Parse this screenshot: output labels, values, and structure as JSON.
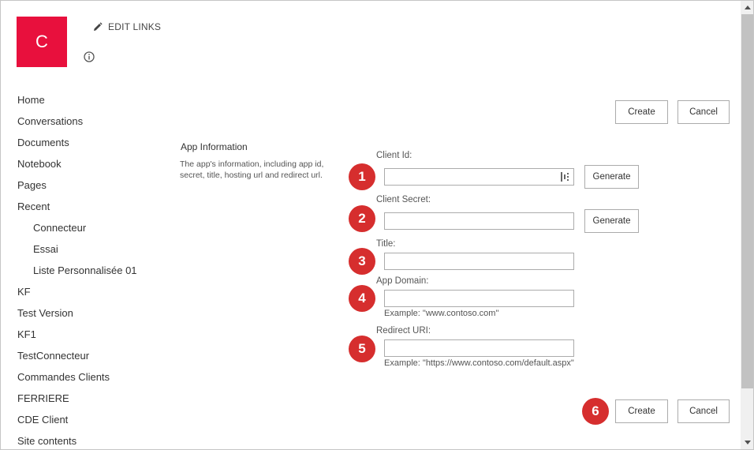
{
  "site": {
    "logo_letter": "C",
    "logo_color": "#e8103d",
    "edit_links": "EDIT LINKS",
    "info_icon": "info-icon"
  },
  "nav": {
    "items": [
      {
        "label": "Home",
        "sub": false
      },
      {
        "label": "Conversations",
        "sub": false
      },
      {
        "label": "Documents",
        "sub": false
      },
      {
        "label": "Notebook",
        "sub": false
      },
      {
        "label": "Pages",
        "sub": false
      },
      {
        "label": "Recent",
        "sub": false
      },
      {
        "label": "Connecteur",
        "sub": true
      },
      {
        "label": "Essai",
        "sub": true
      },
      {
        "label": "Liste Personnalisée 01",
        "sub": true
      },
      {
        "label": "KF",
        "sub": false
      },
      {
        "label": "Test Version",
        "sub": false
      },
      {
        "label": "KF1",
        "sub": false
      },
      {
        "label": "TestConnecteur",
        "sub": false
      },
      {
        "label": "Commandes Clients",
        "sub": false
      },
      {
        "label": "FERRIERE",
        "sub": false
      },
      {
        "label": "CDE Client",
        "sub": false
      },
      {
        "label": "Site contents",
        "sub": false
      }
    ]
  },
  "actions": {
    "create_label": "Create",
    "cancel_label": "Cancel"
  },
  "form": {
    "section_title": "App Information",
    "section_description": "The app's information, including app id, secret, title, hosting url and redirect url.",
    "client_id": {
      "label": "Client Id:",
      "value": "",
      "generate_label": "Generate"
    },
    "client_secret": {
      "label": "Client Secret:",
      "value": "",
      "generate_label": "Generate"
    },
    "title": {
      "label": "Title:",
      "value": ""
    },
    "app_domain": {
      "label": "App Domain:",
      "value": "",
      "example": "Example: \"www.contoso.com\""
    },
    "redirect_uri": {
      "label": "Redirect URI:",
      "value": "",
      "example": "Example: \"https://www.contoso.com/default.aspx\""
    }
  },
  "annotations": {
    "badges": [
      "1",
      "2",
      "3",
      "4",
      "5",
      "6"
    ],
    "badge_color": "#d62e2e"
  }
}
